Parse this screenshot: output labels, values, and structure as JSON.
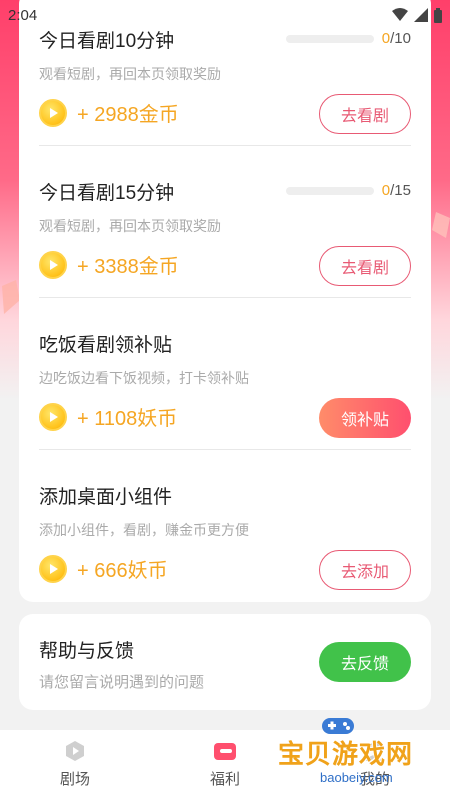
{
  "status_bar": {
    "time": "2:04"
  },
  "tasks": [
    {
      "title": "今日看剧10分钟",
      "desc": "观看短剧，再回本页领取奖励",
      "reward": "+ 2988金币",
      "progress_current": "0",
      "progress_total": "/10",
      "progress_fraction": 0,
      "button": "去看剧",
      "button_style": "outline"
    },
    {
      "title": "今日看剧15分钟",
      "desc": "观看短剧，再回本页领取奖励",
      "reward": "+ 3388金币",
      "progress_current": "0",
      "progress_total": "/15",
      "progress_fraction": 0,
      "button": "去看剧",
      "button_style": "outline"
    },
    {
      "title": "吃饭看剧领补贴",
      "desc": "边吃饭边看下饭视频，打卡领补贴",
      "reward": "+ 1108妖币",
      "button": "领补贴",
      "button_style": "filled"
    },
    {
      "title": "添加桌面小组件",
      "desc": "添加小组件，看剧，赚金币更方便",
      "reward": "+ 666妖币",
      "button": "去添加",
      "button_style": "outline"
    }
  ],
  "help": {
    "title": "帮助与反馈",
    "desc": "请您留言说明遇到的问题",
    "button": "去反馈"
  },
  "tabs": [
    {
      "label": "剧场",
      "icon": "play-icon",
      "active": false
    },
    {
      "label": "福利",
      "icon": "gift-icon",
      "active": true
    },
    {
      "label": "我的",
      "icon": "user-icon",
      "active": false
    }
  ],
  "watermark": {
    "text": "宝贝游戏网",
    "url": "baobeiy.com"
  },
  "colors": {
    "accent": "#ff4f6e",
    "coin_text": "#f5a623",
    "green": "#41c24a"
  }
}
